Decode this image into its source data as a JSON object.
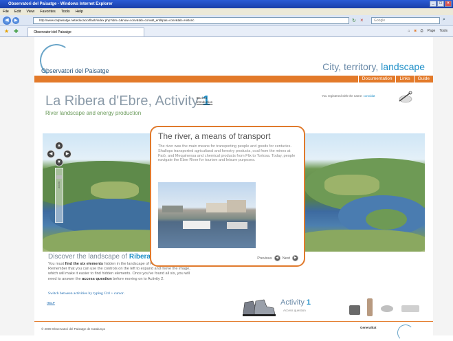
{
  "browser": {
    "window_title": "Observatori del Paisatge - Windows Internet Explorer",
    "menu": [
      "File",
      "Edit",
      "View",
      "Favorites",
      "Tools",
      "Help"
    ],
    "address": "http://www.catpaisatge.net/educacio/flash/index.php?idm=1&now=conv&tab=conv&t_entlitpas=conv&tab=Historic",
    "search_placeholder": "Google",
    "tab_title": "Observatori del Paisatge",
    "tools": [
      "Page",
      "Tools"
    ]
  },
  "site": {
    "logo_text": "Observatori del Paisatge",
    "tagline_pre": "City, territory, ",
    "tagline_highlight": "landscape",
    "nav": [
      "Documentation",
      "Links",
      "Guide"
    ]
  },
  "activity": {
    "title": "La Ribera d'Ebre, Activity ",
    "number": "1",
    "back_link_line1": "Back to",
    "back_link_line2": "introduction",
    "subtitle": "River landscape and energy production",
    "registered_text": "You registered with the name: ",
    "registered_name": "convidat"
  },
  "panorama": {
    "zoom_label": "zoom"
  },
  "discover": {
    "title_pre": "Discover the landscape of ",
    "title_highlight": "Ribera",
    "text_1": "You must ",
    "text_bold_1": "find the six elements",
    "text_2": " hidden in the landscape of Ribera d'Ebre. Remember that you can use the controls on the left to expand and move the image, which will make it easier to find hidden elements. Once you've found all six, you will need to answer the ",
    "text_bold_2": "access question",
    "text_3": " before moving on to Activity 2.",
    "switch_note": "Switch between activities by typing  Ctrl + cursor.",
    "help": "HELP"
  },
  "items": {
    "activity_label": "Activity ",
    "activity_number": "1",
    "access_question": "Access question"
  },
  "popup": {
    "title": "The river, a means of transport",
    "text": "The river was the main means for transporting people and goods for centuries. Shallops transported agricultural and forestry products, coal from the mines at Faió, and Mequinensa and chemical products from Flix to Tortosa. Today, people navigate the Ebre River for tourism and leisure purposes.",
    "prev": "Previous",
    "next": "Next"
  },
  "footer": {
    "copyright": "© 2009 Observatori del Paisatge de Catalunya",
    "gen": "Generalitat"
  },
  "colors": {
    "accent_orange": "#e37a2a",
    "accent_blue": "#1e8fc8"
  }
}
